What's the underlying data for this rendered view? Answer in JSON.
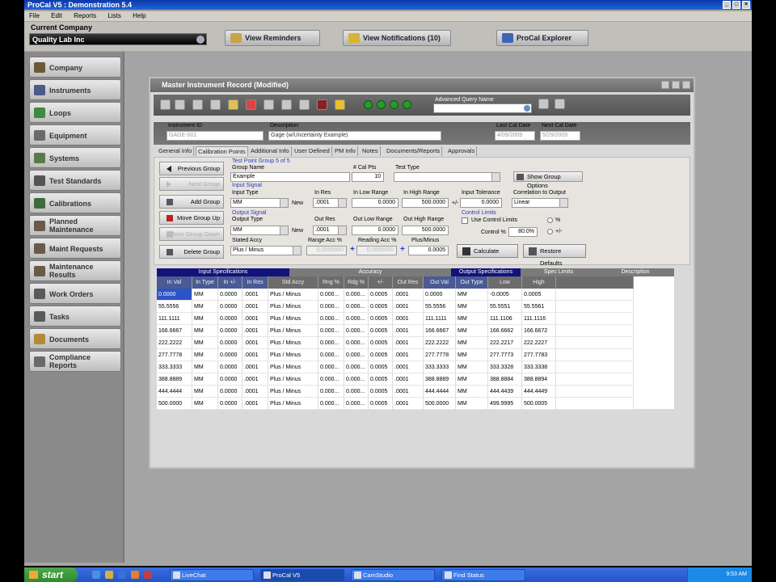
{
  "app": {
    "title": "ProCal V5 : Demonstration 5.4",
    "menu": [
      "File",
      "Edit",
      "Reports",
      "Lists",
      "Help"
    ]
  },
  "topbar": {
    "company_label": "Current Company",
    "company_value": "Quality Lab Inc",
    "buttons": [
      {
        "label": "View Reminders",
        "icon": "folder-icon"
      },
      {
        "label": "View Notifications (10)",
        "icon": "envelope-icon"
      },
      {
        "label": "ProCal Explorer",
        "icon": "explorer-icon"
      }
    ]
  },
  "nav": [
    {
      "label": "Company"
    },
    {
      "label": "Instruments"
    },
    {
      "label": "Loops"
    },
    {
      "label": "Equipment"
    },
    {
      "label": "Systems"
    },
    {
      "label": "Test Standards"
    },
    {
      "label": "Calibrations"
    },
    {
      "label": "Planned Maintenance"
    },
    {
      "label": "Maint Requests"
    },
    {
      "label": "Maintenance Results"
    },
    {
      "label": "Work Orders"
    },
    {
      "label": "Tasks"
    },
    {
      "label": "Documents"
    },
    {
      "label": "Compliance Reports"
    }
  ],
  "window": {
    "title": "Master Instrument Record (Modified)",
    "advanced_query_label": "Advanced Query Name",
    "header": {
      "instrument_id_label": "Instrument ID",
      "instrument_id_value": "GAGE-001",
      "description_label": "Description",
      "description_value": "Gage (w/Uncertainty Example)",
      "last_cal_label": "Last Cal Date",
      "last_cal_value": "4/09/2009",
      "next_cal_label": "Next Cal Date",
      "next_cal_value": "5/29/2009"
    },
    "tabs": [
      "General Info",
      "Calibration Points",
      "Additional Info",
      "User Defined",
      "PM Info",
      "Notes",
      "Documents/Reports",
      "Approvals"
    ],
    "side_buttons": [
      "Previous Group",
      "Next Group",
      "Add Group",
      "Move Group Up",
      "Move Group Down",
      "Delete Group"
    ],
    "cal_points": {
      "group_title": "Test Point Group 5 of 5",
      "group_name_label": "Group Name",
      "group_name_value": "Example",
      "num_cal_pts_label": "# Cal Pts",
      "num_cal_pts_value": "10",
      "test_type_label": "Test Type",
      "show_group_options": "Show Group Options",
      "input_signal_label": "Input Signal",
      "input_type_label": "Input Type",
      "input_type_value": "MM",
      "new_label": "New",
      "in_res_label": "In Res",
      "in_res_value": ".0001",
      "in_low_range_label": "In Low Range",
      "in_low_range_value": "0.0000",
      "in_high_range_label": "In High Range",
      "in_high_range_value": "500.0000",
      "plus_minus": "+/-",
      "input_tolerance_label": "Input Tolerance",
      "input_tolerance_value": "0.0000",
      "correlation_label": "Correlation to Output",
      "correlation_value": "Linear",
      "output_signal_label": "Output Signal",
      "output_type_label": "Output Type",
      "output_type_value": "MM",
      "out_res_label": "Out Res",
      "out_res_value": ".0001",
      "out_low_range_label": "Out Low Range",
      "out_low_range_value": "0.0000",
      "out_high_range_label": "Out High Range",
      "out_high_range_value": "500.0000",
      "control_limits_label": "Control Limits",
      "use_control_limits": "Use Control Limits",
      "pct_symbol": "%",
      "plus_minus_2": "+/-",
      "control_pct_label": "Control %",
      "control_pct_value": "80.0%",
      "stated_accy_label": "Stated Accy",
      "stated_accy_value": "Plus / Minus",
      "range_acc_label": "Range Acc %",
      "range_acc_value": "0.0000000",
      "reading_acc_label": "Reading Acc %",
      "reading_acc_value": "0.0000000",
      "plus_minus_acc_label": "Plus/Minus",
      "plus_minus_acc_value": "0.0005",
      "calculate": "Calculate",
      "restore_defaults": "Restore Defaults"
    },
    "grid": {
      "groups": [
        "Input Specifications",
        "Accuracy",
        "Output Specifications",
        "Spec Limits",
        "Description"
      ],
      "columns": [
        "In Val",
        "In Type",
        "In +/-",
        "In Res",
        "Std Accy",
        "Rng %",
        "Rdg %",
        "+/-",
        "Out Res",
        "Out Val",
        "Out Type",
        "Low",
        "High",
        ""
      ],
      "rows": [
        [
          "0.0000",
          "MM",
          "0.0000",
          ".0001",
          "Plus / Minus",
          "0.000...",
          "0.000...",
          "0.0005",
          ".0001",
          "0.0000",
          "MM",
          "-0.0005",
          "0.0005",
          ""
        ],
        [
          "55.5556",
          "MM",
          "0.0000",
          ".0001",
          "Plus / Minus",
          "0.000...",
          "0.000...",
          "0.0005",
          ".0001",
          "55.5556",
          "MM",
          "55.5551",
          "55.5561",
          ""
        ],
        [
          "111.1111",
          "MM",
          "0.0000",
          ".0001",
          "Plus / Minus",
          "0.000...",
          "0.000...",
          "0.0005",
          ".0001",
          "111.1111",
          "MM",
          "111.1106",
          "111.1116",
          ""
        ],
        [
          "166.6667",
          "MM",
          "0.0000",
          ".0001",
          "Plus / Minus",
          "0.000...",
          "0.000...",
          "0.0005",
          ".0001",
          "166.6667",
          "MM",
          "166.6662",
          "166.6672",
          ""
        ],
        [
          "222.2222",
          "MM",
          "0.0000",
          ".0001",
          "Plus / Minus",
          "0.000...",
          "0.000...",
          "0.0005",
          ".0001",
          "222.2222",
          "MM",
          "222.2217",
          "222.2227",
          ""
        ],
        [
          "277.7778",
          "MM",
          "0.0000",
          ".0001",
          "Plus / Minus",
          "0.000...",
          "0.000...",
          "0.0005",
          ".0001",
          "277.7778",
          "MM",
          "277.7773",
          "277.7783",
          ""
        ],
        [
          "333.3333",
          "MM",
          "0.0000",
          ".0001",
          "Plus / Minus",
          "0.000...",
          "0.000...",
          "0.0005",
          ".0001",
          "333.3333",
          "MM",
          "333.3328",
          "333.3338",
          ""
        ],
        [
          "388.8889",
          "MM",
          "0.0000",
          ".0001",
          "Plus / Minus",
          "0.000...",
          "0.000...",
          "0.0005",
          ".0001",
          "388.8889",
          "MM",
          "388.8884",
          "388.8894",
          ""
        ],
        [
          "444.4444",
          "MM",
          "0.0000",
          ".0001",
          "Plus / Minus",
          "0.000...",
          "0.000...",
          "0.0005",
          ".0001",
          "444.4444",
          "MM",
          "444.4439",
          "444.4449",
          ""
        ],
        [
          "500.0000",
          "MM",
          "0.0000",
          ".0001",
          "Plus / Minus",
          "0.000...",
          "0.000...",
          "0.0005",
          ".0001",
          "500.0000",
          "MM",
          "499.9995",
          "500.0005",
          ""
        ]
      ]
    }
  },
  "taskbar": {
    "start": "start",
    "tasks": [
      "LiveChat",
      "ProCal V5",
      "CamStudio",
      "Find Status"
    ],
    "clock": "9:53 AM"
  },
  "colors": {
    "title_blue": "#1f55c8",
    "grid_header_blue": "#1a1a7a",
    "selection_blue": "#2d54c4",
    "go_green": "#2a9a2a"
  }
}
